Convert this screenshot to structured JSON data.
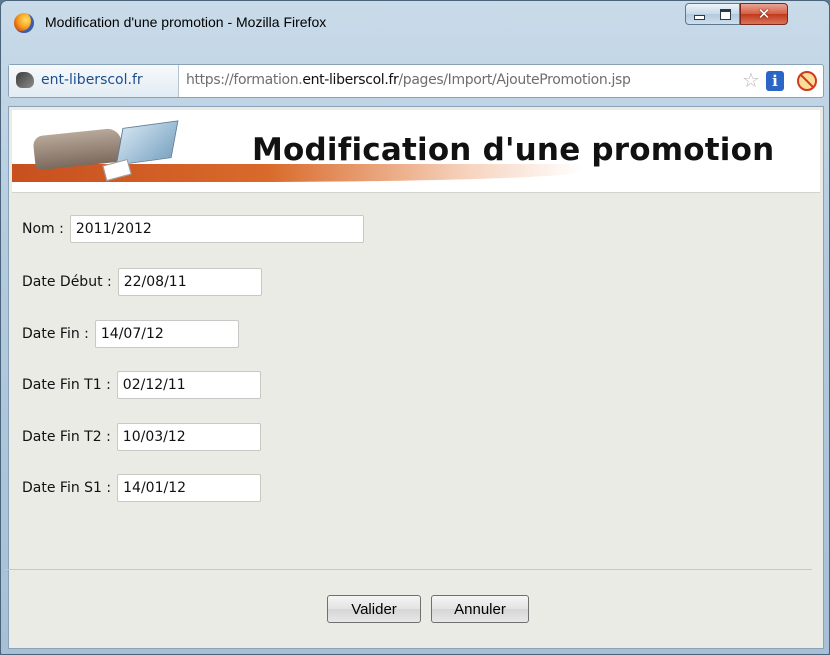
{
  "window": {
    "title": "Modification d'une promotion - Mozilla Firefox",
    "controls": {
      "minimize": "",
      "maximize": "",
      "close": "✕"
    }
  },
  "addressbar": {
    "site_name": "ent-liberscol.fr",
    "url_prefix": "https://formation.",
    "url_domain": "ent-liberscol.fr",
    "url_path": "/pages/Import/AjoutePromotion.jsp"
  },
  "page": {
    "banner_title": "Modification d'une promotion"
  },
  "form": {
    "fields": [
      {
        "label": "Nom :",
        "value": "2011/2012"
      },
      {
        "label": "Date Début :",
        "value": "22/08/11"
      },
      {
        "label": "Date Fin :",
        "value": "14/07/12"
      },
      {
        "label": "Date Fin T1 :",
        "value": "02/12/11"
      },
      {
        "label": "Date Fin T2 :",
        "value": "10/03/12"
      },
      {
        "label": "Date Fin S1 :",
        "value": "14/01/12"
      }
    ]
  },
  "buttons": {
    "validate": "Valider",
    "cancel": "Annuler"
  },
  "icons": {
    "app": "firefox-icon",
    "site": "site-identity-icon",
    "bookmark": "star-icon",
    "info": "info-icon",
    "block": "blocked-icon"
  }
}
